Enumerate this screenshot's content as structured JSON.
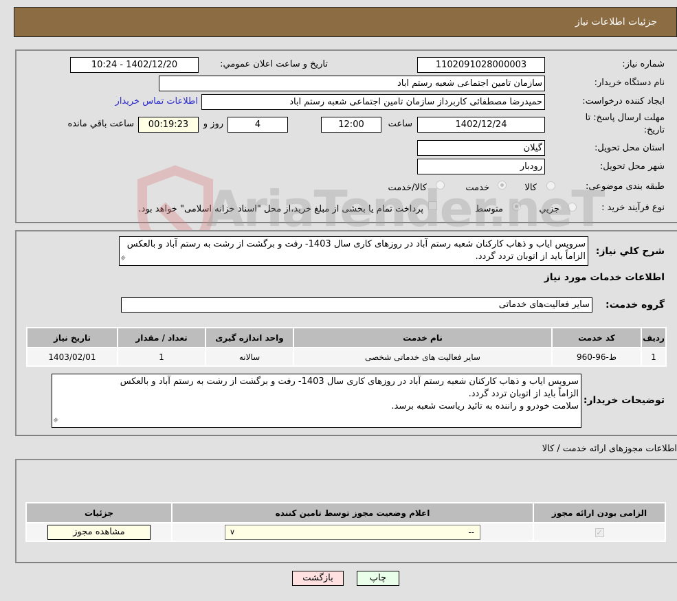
{
  "header": {
    "title": "جزئیات اطلاعات نیاز"
  },
  "form": {
    "need_number_label": "شماره نیاز:",
    "need_number": "1102091028000003",
    "announce_label": "تاریخ و ساعت اعلان عمومي:",
    "announce_value": "1402/12/20 - 10:24",
    "buyer_org_label": "نام دستگاه خریدار:",
    "buyer_org": "سازمان تامین اجتماعی شعبه رستم اباد",
    "creator_label": "ایجاد کننده درخواست:",
    "creator": "حمیدرضا مصطفائی کاربرداز سازمان تامین اجتماعی شعبه رستم اباد",
    "contact_link": "اطلاعات تماس خریدار",
    "deadline_label_line1": "مهلت ارسال پاسخ: تا",
    "deadline_label_line2": "تاریخ:",
    "deadline_date": "1402/12/24",
    "time_label": "ساعت",
    "deadline_time": "12:00",
    "days_value": "4",
    "days_label": "روز و",
    "remaining_time": "00:19:23",
    "remaining_label": "ساعت باقي مانده",
    "province_label": "استان محل تحویل:",
    "province": "گیلان",
    "city_label": "شهر محل تحویل:",
    "city": "رودبار",
    "category_label": "طبقه بندی موضوعی:",
    "category_options": [
      "کالا",
      "خدمت",
      "کالا/خدمت"
    ],
    "category_selected": "خدمت",
    "process_label": "نوع فرآیند خرید :",
    "process_options": [
      "جزیي",
      "متوسط"
    ],
    "process_selected": "متوسط",
    "payment_note": "پرداخت تمام یا بخشی از مبلغ خرید،از محل \"اسناد خزانه اسلامی\" خواهد بود."
  },
  "description": {
    "label": "شرح کلي نیاز:",
    "text": "سرویس ایاب و ذهاب کارکنان شعبه رستم آباد در روزهای کاری سال 1403- رفت و برگشت از رشت به رستم آباد و بالعکس الزاماً باید از اتوبان تردد گردد.",
    "services_heading": "اطلاعات خدمات مورد نیاز",
    "service_group_label": "گروه خدمت:",
    "service_group": "سایر فعالیت‌های خدماتی"
  },
  "services_table": {
    "headers": [
      "ردیف",
      "کد خدمت",
      "نام خدمت",
      "واحد اندازه گیری",
      "تعداد / مقدار",
      "تاریخ نیاز"
    ],
    "rows": [
      [
        "1",
        "ط-96-960",
        "سایر فعالیت های خدماتی شخصی",
        "سالانه",
        "1",
        "1403/02/01"
      ]
    ]
  },
  "buyer_notes": {
    "label": "توضیحات خریدار:",
    "line1": "سرویس ایاب و ذهاب کارکنان شعبه رستم آباد در روزهای کاری سال 1403- رفت و برگشت از رشت به رستم آباد و بالعکس",
    "line2": "الزاماً باید از اتوبان تردد گردد.",
    "line3": "سلامت خودرو و راننده به تائید ریاست شعبه برسد."
  },
  "permits": {
    "title": "اطلاعات مجوزهای ارائه خدمت / کالا",
    "headers": [
      "الزامی بودن ارائه مجوز",
      "اعلام وضعیت مجوز توسط تامین کننده",
      "جزئیات"
    ],
    "required_checked": true,
    "status_value": "--",
    "view_button": "مشاهده مجوز"
  },
  "footer": {
    "print_button": "چاپ",
    "back_button": "بازگشت"
  },
  "watermark": {
    "text": "AriaTender.neT"
  }
}
